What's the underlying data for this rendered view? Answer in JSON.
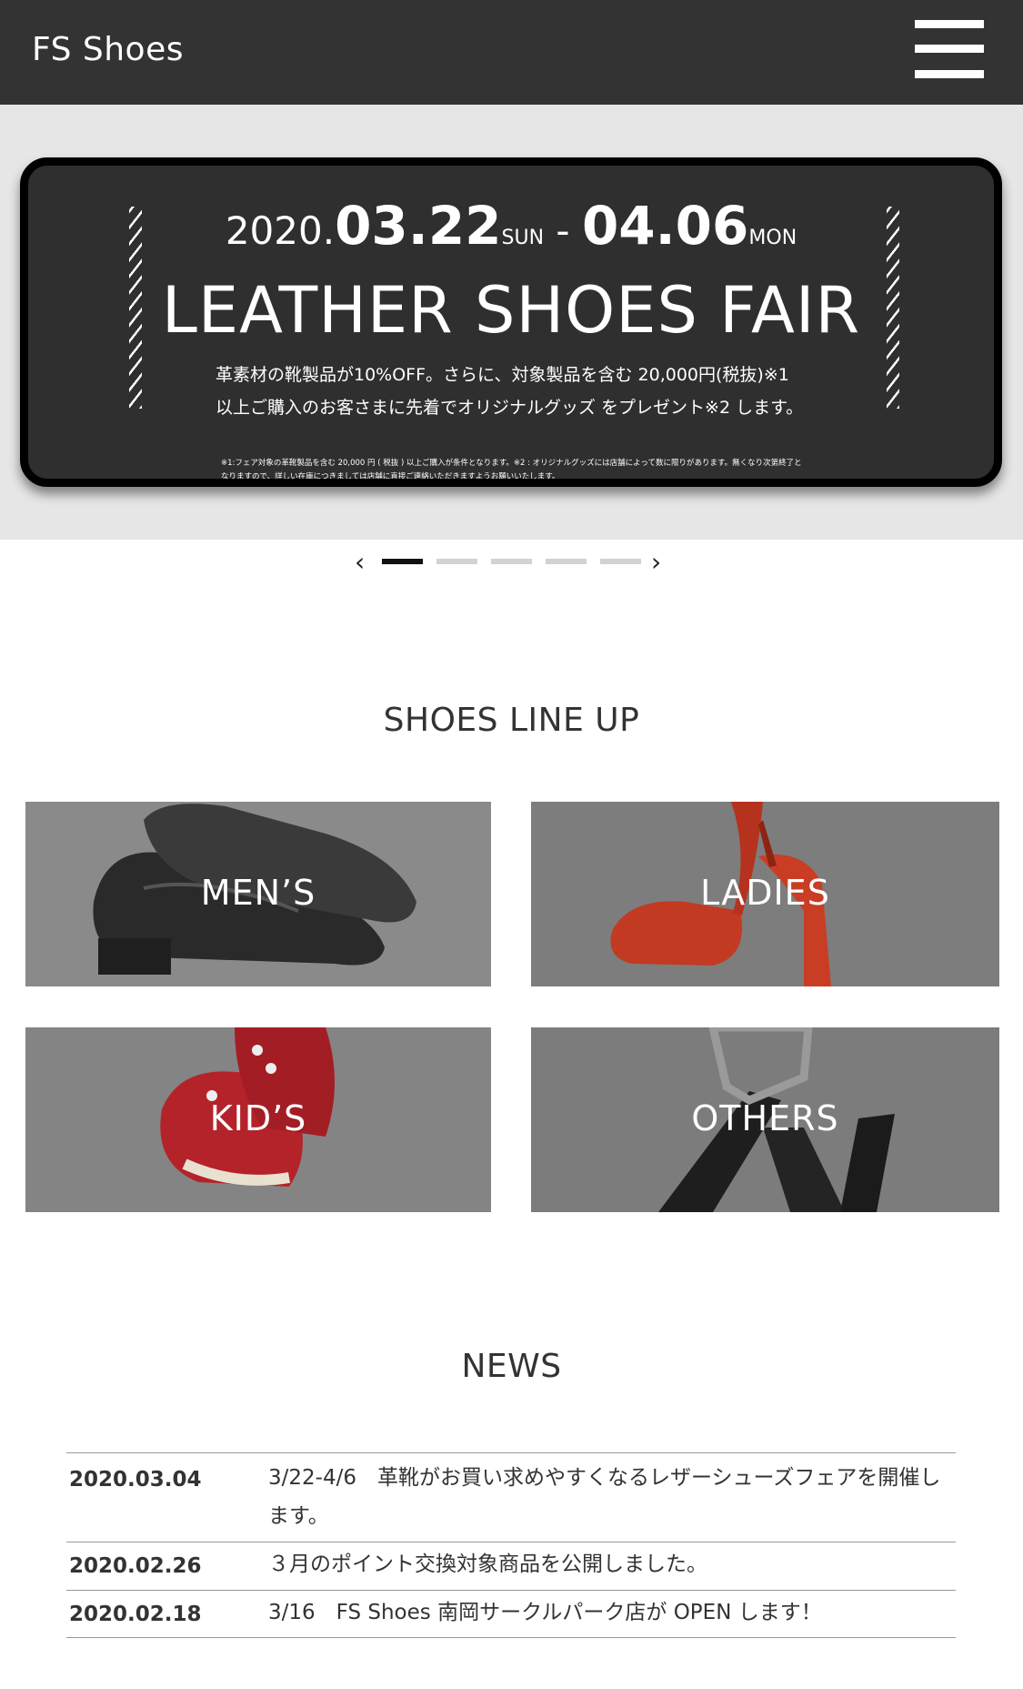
{
  "header": {
    "logo": "FS Shoes",
    "menu_icon": "hamburger-icon"
  },
  "hero": {
    "date_start_year": "2020.",
    "date_start_md": "03.22",
    "date_start_dow": "SUN",
    "date_sep": " - ",
    "date_end_md": "04.06",
    "date_end_dow": "MON",
    "title": "LEATHER SHOES FAIR",
    "text_line1": "革素材の靴製品が10%OFF。さらに、対象製品を含む 20,000円(税抜)※1",
    "text_line2": "以上ご購入のお客さまに先着でオリジナルグッズ をプレゼント※2 します。",
    "note": "※1:フェア対象の革靴製品を含む 20,000 円 ( 税抜 ) 以上ご購入が条件となります。※2 : オリジナルグッズには店舗によって数に限りがあります。無くなり次第終了となりますので、詳しい在庫につきましては店舗に直接ご連絡いただきますようお願いいたします。"
  },
  "carousel": {
    "prev_icon": "chevron-left-icon",
    "next_icon": "chevron-right-icon",
    "slide_count": 5,
    "active_index": 0
  },
  "lineup": {
    "title": "SHOES LINE UP",
    "categories": [
      {
        "label": "MEN’S"
      },
      {
        "label": "LADIES"
      },
      {
        "label": "KID’S"
      },
      {
        "label": "OTHERS"
      }
    ]
  },
  "news": {
    "title": "NEWS",
    "items": [
      {
        "date": "2020.03.04",
        "text": "3/22-4/6　革靴がお買い求めやすくなるレザーシューズフェアを開催します。"
      },
      {
        "date": "2020.02.26",
        "text": "３月のポイント交換対象商品を公開しました。"
      },
      {
        "date": "2020.02.18",
        "text": "3/16　FS Shoes 南岡サークルパーク店が OPEN します！"
      }
    ]
  }
}
